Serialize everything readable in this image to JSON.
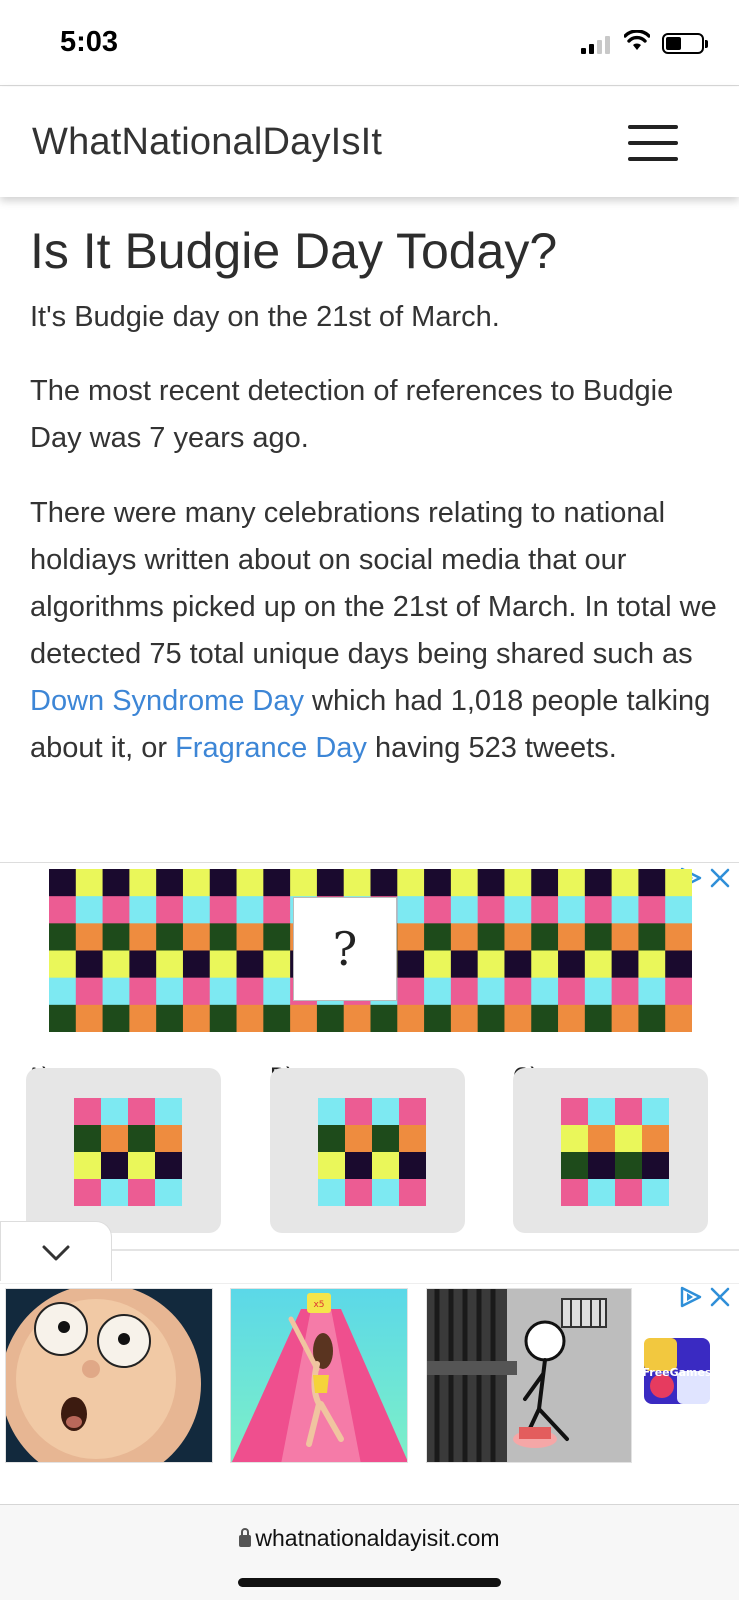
{
  "status_bar": {
    "time": "5:03",
    "icons": [
      "signal-icon",
      "wifi-icon",
      "battery-icon"
    ]
  },
  "header": {
    "site_name": "WhatNationalDayIsIt",
    "menu_icon": "hamburger-menu-icon"
  },
  "article": {
    "title": "Is It Budgie Day Today?",
    "paragraph_date": "It's Budgie day on the 21st of March.",
    "paragraph_recent": "The most recent detection of references to Budgie Day was 7 years ago.",
    "paragraph_stats": {
      "part1": "There were many celebrations relating to national holdiays written about on social media that our algorithms picked up on the 21st of March. In total we detected 75 total unique days being shared such as ",
      "link1": "Down Syndrome Day",
      "part2": " which had 1,018 people talking about it, or ",
      "link2": "Fragrance Day",
      "part3": " having 523 tweets."
    }
  },
  "ad_puzzle": {
    "question_mark": "?",
    "options": [
      "A)",
      "B)",
      "C)"
    ],
    "palette": {
      "black": "#1a0a2e",
      "lime": "#eaf75a",
      "pink": "#ec5c93",
      "cyan": "#7de9f2",
      "orange": "#ee8c3f",
      "green": "#1e4b1b"
    },
    "icons": [
      "adchoices-icon",
      "close-icon",
      "chevron-down-icon"
    ]
  },
  "ad_games": {
    "tiles": [
      "cartoon-face-thumbnail",
      "runner-game-thumbnail",
      "stickman-prison-thumbnail",
      "freegames-logo"
    ],
    "freegames_text": "FreeGames",
    "runner_badge": "x5",
    "icons": [
      "adchoices-icon",
      "close-icon"
    ]
  },
  "url_bar": {
    "url": "whatnationaldayisit.com",
    "lock_icon": "lock-icon"
  }
}
